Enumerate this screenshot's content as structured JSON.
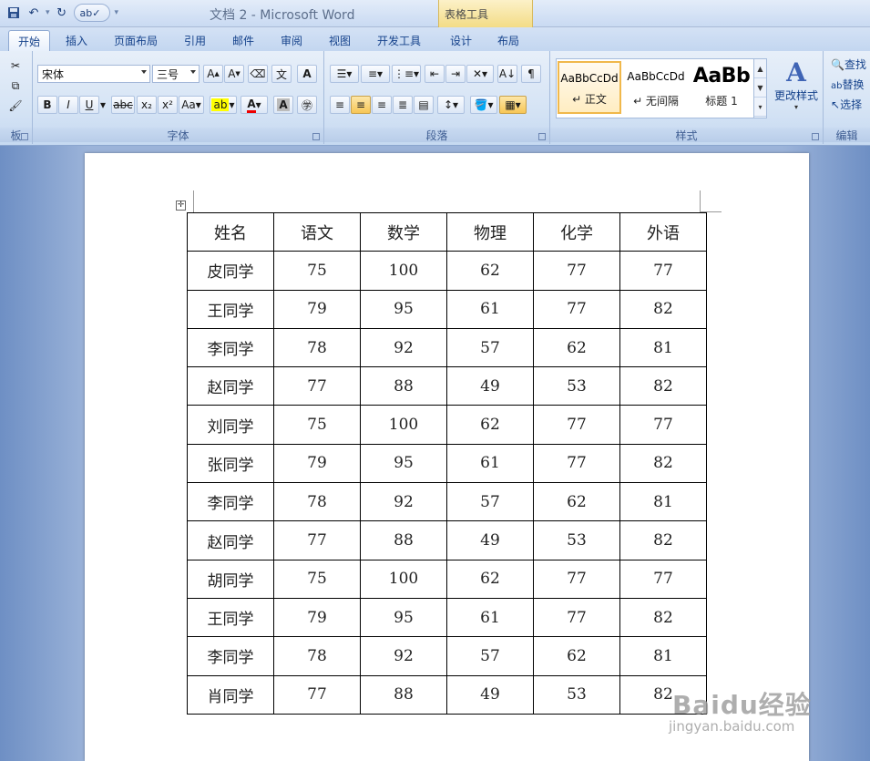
{
  "titlebar": {
    "doc_title": "文档 2 - Microsoft Word",
    "context_title": "表格工具"
  },
  "tabs": [
    {
      "label": "开始",
      "active": true
    },
    {
      "label": "插入"
    },
    {
      "label": "页面布局"
    },
    {
      "label": "引用"
    },
    {
      "label": "邮件"
    },
    {
      "label": "审阅"
    },
    {
      "label": "视图"
    },
    {
      "label": "开发工具"
    },
    {
      "label": "设计"
    },
    {
      "label": "布局"
    }
  ],
  "ribbon": {
    "clipboard_label": "板",
    "font": {
      "label": "字体",
      "font_name": "宋体",
      "font_size": "三号"
    },
    "paragraph": {
      "label": "段落"
    },
    "styles": {
      "label": "样式",
      "items": [
        {
          "sample": "AaBbCcDd",
          "name": "↵ 正文"
        },
        {
          "sample": "AaBbCcDd",
          "name": "↵ 无间隔"
        },
        {
          "sample": "AaBb",
          "name": "标题 1"
        }
      ],
      "change_styles": "更改样式"
    },
    "editing": {
      "label": "编辑",
      "find": "查找",
      "replace": "替换",
      "select": "选择"
    }
  },
  "table": {
    "headers": [
      "姓名",
      "语文",
      "数学",
      "物理",
      "化学",
      "外语"
    ],
    "rows": [
      [
        "皮同学",
        "75",
        "100",
        "62",
        "77",
        "77"
      ],
      [
        "王同学",
        "79",
        "95",
        "61",
        "77",
        "82"
      ],
      [
        "李同学",
        "78",
        "92",
        "57",
        "62",
        "81"
      ],
      [
        "赵同学",
        "77",
        "88",
        "49",
        "53",
        "82"
      ],
      [
        "刘同学",
        "75",
        "100",
        "62",
        "77",
        "77"
      ],
      [
        "张同学",
        "79",
        "95",
        "61",
        "77",
        "82"
      ],
      [
        "李同学",
        "78",
        "92",
        "57",
        "62",
        "81"
      ],
      [
        "赵同学",
        "77",
        "88",
        "49",
        "53",
        "82"
      ],
      [
        "胡同学",
        "75",
        "100",
        "62",
        "77",
        "77"
      ],
      [
        "王同学",
        "79",
        "95",
        "61",
        "77",
        "82"
      ],
      [
        "李同学",
        "78",
        "92",
        "57",
        "62",
        "81"
      ],
      [
        "肖同学",
        "77",
        "88",
        "49",
        "53",
        "82"
      ]
    ]
  },
  "watermark": {
    "main": "Baidu经验",
    "url": "jingyan.baidu.com"
  }
}
